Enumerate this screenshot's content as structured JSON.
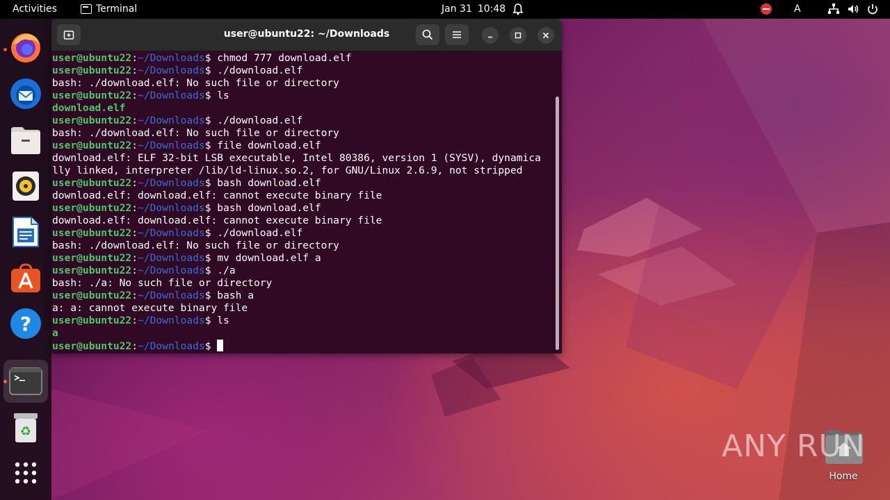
{
  "topbar": {
    "activities": "Activities",
    "app_name": "Terminal",
    "date": "Jan 31",
    "time": "10:48",
    "language": "A"
  },
  "dock": {
    "items": [
      {
        "name": "firefox",
        "running": true
      },
      {
        "name": "thunderbird",
        "running": false
      },
      {
        "name": "files",
        "running": false
      },
      {
        "name": "rhythmbox",
        "running": false
      },
      {
        "name": "libreoffice-writer",
        "running": false
      },
      {
        "name": "app-center",
        "running": false
      },
      {
        "name": "help",
        "running": false
      },
      {
        "name": "terminal",
        "running": true
      },
      {
        "name": "trash",
        "running": false
      },
      {
        "name": "show-apps",
        "running": false
      }
    ]
  },
  "terminal": {
    "title": "user@ubuntu22: ~/Downloads",
    "prompt_user": "user@ubuntu22",
    "prompt_sep": ":",
    "prompt_path": "~/Downloads",
    "prompt_end": "$ ",
    "lines": [
      {
        "type": "cmd",
        "text": "chmod 777 download.elf"
      },
      {
        "type": "cmd",
        "text": "./download.elf"
      },
      {
        "type": "out",
        "text": "bash: ./download.elf: No such file or directory"
      },
      {
        "type": "cmd",
        "text": "ls"
      },
      {
        "type": "out_green",
        "text": "download.elf"
      },
      {
        "type": "cmd",
        "text": "./download.elf"
      },
      {
        "type": "out",
        "text": "bash: ./download.elf: No such file or directory"
      },
      {
        "type": "cmd",
        "text": "file download.elf"
      },
      {
        "type": "out",
        "text": "download.elf: ELF 32-bit LSB executable, Intel 80386, version 1 (SYSV), dynamica"
      },
      {
        "type": "out",
        "text": "lly linked, interpreter /lib/ld-linux.so.2, for GNU/Linux 2.6.9, not stripped"
      },
      {
        "type": "cmd",
        "text": "bash download.elf"
      },
      {
        "type": "out",
        "text": "download.elf: download.elf: cannot execute binary file"
      },
      {
        "type": "cmd",
        "text": "bash download.elf"
      },
      {
        "type": "out",
        "text": "download.elf: download.elf: cannot execute binary file"
      },
      {
        "type": "cmd",
        "text": "./download.elf"
      },
      {
        "type": "out",
        "text": "bash: ./download.elf: No such file or directory"
      },
      {
        "type": "cmd",
        "text": "mv download.elf a"
      },
      {
        "type": "cmd",
        "text": "./a"
      },
      {
        "type": "out",
        "text": "bash: ./a: No such file or directory"
      },
      {
        "type": "cmd",
        "text": "bash a"
      },
      {
        "type": "out",
        "text": "a: a: cannot execute binary file"
      },
      {
        "type": "cmd",
        "text": "ls"
      },
      {
        "type": "out_green",
        "text": "a"
      },
      {
        "type": "prompt",
        "text": ""
      }
    ]
  },
  "desktop": {
    "home_label": "Home",
    "watermark": "ANY RUN"
  },
  "colors": {
    "terminal_bg": "#300a24",
    "prompt_user": "#4ec66a",
    "prompt_path": "#3a6cd4",
    "accent": "#e95420"
  }
}
